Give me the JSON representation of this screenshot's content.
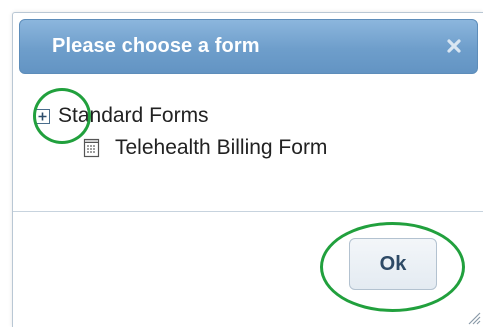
{
  "dialog": {
    "title": "Please choose a form",
    "close_icon": "close-icon",
    "ok_label": "Ok"
  },
  "tree": {
    "root": {
      "label": "Standard Forms",
      "icon": "plus-square-icon",
      "expanded": false
    },
    "children": [
      {
        "label": "Telehealth Billing Form",
        "icon": "form-document-icon"
      }
    ]
  },
  "colors": {
    "titlebar_top": "#8cb6dd",
    "titlebar_bottom": "#6394c3",
    "annotation_circle": "#21a03d",
    "ok_text": "#2e4a66"
  }
}
